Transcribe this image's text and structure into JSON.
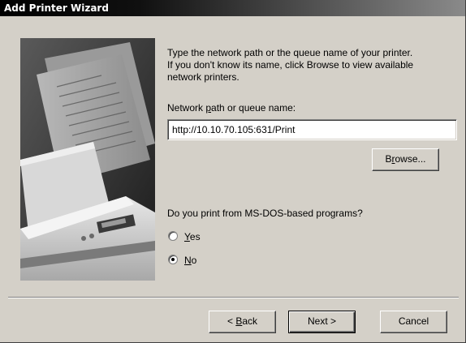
{
  "window": {
    "title": "Add Printer Wizard"
  },
  "wizard": {
    "instruction_lines": [
      "Type the network path or the queue name of your printer.",
      "If you don't know its name, click Browse to view available",
      "network printers."
    ],
    "path_label_pre": "Network ",
    "path_label_key": "p",
    "path_label_post": "ath or queue name:",
    "path_value": "http://10.10.70.105:631/Print",
    "browse_pre": "B",
    "browse_key": "r",
    "browse_post": "owse...",
    "question": "Do you print from MS-DOS-based programs?",
    "radio_yes_key": "Y",
    "radio_yes_rest": "es",
    "radio_no_key": "N",
    "radio_no_rest": "o",
    "selected_option": "No"
  },
  "footer": {
    "back_pre": "< ",
    "back_key": "B",
    "back_post": "ack",
    "next_label": "Next >",
    "cancel_label": "Cancel"
  }
}
